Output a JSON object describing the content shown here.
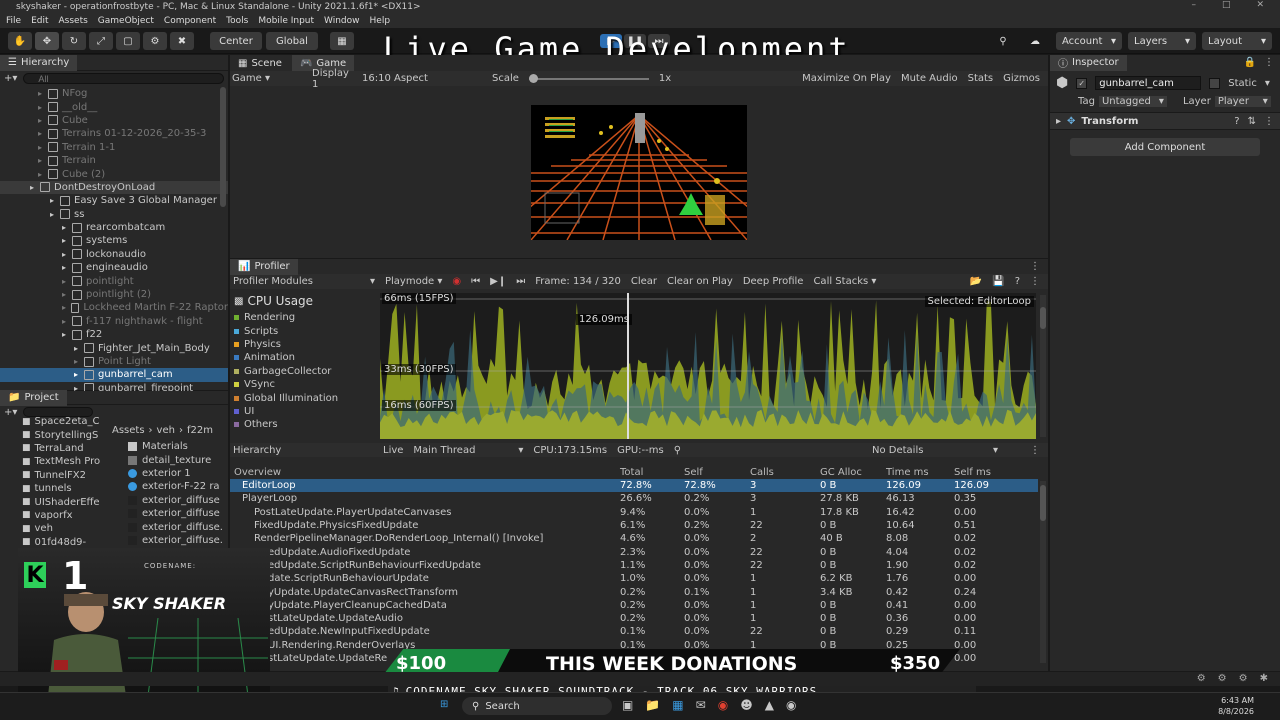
{
  "window": {
    "title": "skyshaker - operationfrostbyte - PC, Mac & Linux Standalone - Unity 2021.1.6f1* <DX11>"
  },
  "menu": [
    "File",
    "Edit",
    "Assets",
    "GameObject",
    "Component",
    "Tools",
    "Mobile Input",
    "Window",
    "Help"
  ],
  "toolbar": {
    "pivot": "Center",
    "space": "Global",
    "account": "Account",
    "layers": "Layers",
    "layout": "Layout"
  },
  "overlay": {
    "title": "Live Game Development"
  },
  "hierarchy": {
    "tab": "Hierarchy",
    "search_placeholder": "All",
    "rows": [
      {
        "label": "NFog",
        "indent": 0,
        "dim": true
      },
      {
        "label": "__old__",
        "indent": 0,
        "dim": true
      },
      {
        "label": "Cube",
        "indent": 0,
        "dim": true
      },
      {
        "label": "Terrains 01-12-2026_20-35-3",
        "indent": 0,
        "dim": true
      },
      {
        "label": "Terrain 1-1",
        "indent": 0,
        "dim": true
      },
      {
        "label": "Terrain",
        "indent": 0,
        "dim": true
      },
      {
        "label": "Cube (2)",
        "indent": 0,
        "dim": true
      },
      {
        "label": "DontDestroyOnLoad",
        "indent": -1,
        "dim": false
      },
      {
        "label": "Easy Save 3 Global Manager",
        "indent": 1,
        "dim": false
      },
      {
        "label": "ss",
        "indent": 1,
        "dim": false
      },
      {
        "label": "rearcombatcam",
        "indent": 2,
        "dim": false
      },
      {
        "label": "systems",
        "indent": 2,
        "dim": false
      },
      {
        "label": "lockonaudio",
        "indent": 2,
        "dim": false
      },
      {
        "label": "engineaudio",
        "indent": 2,
        "dim": false
      },
      {
        "label": "pointlight",
        "indent": 2,
        "dim": true
      },
      {
        "label": "pointlight (2)",
        "indent": 2,
        "dim": true
      },
      {
        "label": "Lockheed Martin F-22 Raptor",
        "indent": 2,
        "dim": true
      },
      {
        "label": "f-117 nighthawk - flight",
        "indent": 2,
        "dim": true
      },
      {
        "label": "f22",
        "indent": 2,
        "dim": false
      },
      {
        "label": "Fighter_Jet_Main_Body",
        "indent": 3,
        "dim": false
      },
      {
        "label": "Point Light",
        "indent": 3,
        "dim": true
      },
      {
        "label": "gunbarrel_cam",
        "indent": 3,
        "dim": false
      },
      {
        "label": "gunbarrel_firepoint",
        "indent": 3,
        "dim": false
      }
    ]
  },
  "project": {
    "tab": "Project",
    "breadcrumb": [
      "Assets",
      "veh",
      "f22m"
    ],
    "folders": [
      "Space2eta_C",
      "StorytellingS",
      "TerraLand",
      "TextMesh Pro",
      "TunnelFX2",
      "tunnels",
      "UIShaderEffe",
      "vaporfx",
      "veh",
      "01fd48d9-"
    ],
    "files": [
      "Materials",
      "detail_texture",
      "exterior 1",
      "exterior-F-22 ra",
      "exterior_diffuse",
      "exterior_diffuse",
      "exterior_diffuse.",
      "exterior_diffuse."
    ]
  },
  "scene": {
    "tabs": [
      "Scene",
      "Game"
    ],
    "display": "Game",
    "display_num": "Display 1",
    "aspect": "16:10 Aspect",
    "scale_label": "Scale",
    "scale_value": "1x",
    "right_items": [
      "Maximize On Play",
      "Mute Audio",
      "Stats",
      "Gizmos"
    ]
  },
  "profiler": {
    "tab": "Profiler",
    "modules": "Profiler Modules",
    "mode": "Playmode",
    "frame": "Frame: 134 / 320",
    "buttons": [
      "Clear",
      "Clear on Play",
      "Deep Profile",
      "Call Stacks"
    ],
    "module_name": "CPU Usage",
    "legend": [
      {
        "name": "Rendering",
        "color": "#70b030"
      },
      {
        "name": "Scripts",
        "color": "#4aa8d8"
      },
      {
        "name": "Physics",
        "color": "#e8a020"
      },
      {
        "name": "Animation",
        "color": "#3a7ac0"
      },
      {
        "name": "GarbageCollector",
        "color": "#b0b060"
      },
      {
        "name": "VSync",
        "color": "#d0d040"
      },
      {
        "name": "Global Illumination",
        "color": "#d08030"
      },
      {
        "name": "UI",
        "color": "#6060d0"
      },
      {
        "name": "Others",
        "color": "#8a6aa0"
      }
    ],
    "lines": [
      "66ms (15FPS)",
      "33ms (30FPS)",
      "16ms (60FPS)"
    ],
    "selected_label": "Selected: EditorLoop",
    "marker": "126.09ms",
    "view": "Hierarchy",
    "live": "Live",
    "thread": "Main Thread",
    "cpu": "CPU:173.15ms",
    "gpu": "GPU:--ms",
    "details": "No Details",
    "columns": [
      "Overview",
      "Total",
      "Self",
      "Calls",
      "GC Alloc",
      "Time ms",
      "Self ms"
    ],
    "rows": [
      [
        "EditorLoop",
        "72.8%",
        "72.8%",
        "3",
        "0 B",
        "126.09",
        "126.09"
      ],
      [
        "PlayerLoop",
        "26.6%",
        "0.2%",
        "3",
        "27.8 KB",
        "46.13",
        "0.35"
      ],
      [
        "PostLateUpdate.PlayerUpdateCanvases",
        "9.4%",
        "0.0%",
        "1",
        "17.8 KB",
        "16.42",
        "0.00"
      ],
      [
        "FixedUpdate.PhysicsFixedUpdate",
        "6.1%",
        "0.2%",
        "22",
        "0 B",
        "10.64",
        "0.51"
      ],
      [
        "RenderPipelineManager.DoRenderLoop_Internal() [Invoke]",
        "4.6%",
        "0.0%",
        "2",
        "40 B",
        "8.08",
        "0.02"
      ],
      [
        "edUpdate.AudioFixedUpdate",
        "2.3%",
        "0.0%",
        "22",
        "0 B",
        "4.04",
        "0.02"
      ],
      [
        "edUpdate.ScriptRunBehaviourFixedUpdate",
        "1.1%",
        "0.0%",
        "22",
        "0 B",
        "1.90",
        "0.02"
      ],
      [
        "date.ScriptRunBehaviourUpdate",
        "1.0%",
        "0.0%",
        "1",
        "6.2 KB",
        "1.76",
        "0.00"
      ],
      [
        "yUpdate.UpdateCanvasRectTransform",
        "0.2%",
        "0.1%",
        "1",
        "3.4 KB",
        "0.42",
        "0.24"
      ],
      [
        "yUpdate.PlayerCleanupCachedData",
        "0.2%",
        "0.0%",
        "1",
        "0 B",
        "0.41",
        "0.00"
      ],
      [
        "stLateUpdate.UpdateAudio",
        "0.2%",
        "0.0%",
        "1",
        "0 B",
        "0.36",
        "0.00"
      ],
      [
        "edUpdate.NewInputFixedUpdate",
        "0.1%",
        "0.0%",
        "22",
        "0 B",
        "0.29",
        "0.11"
      ],
      [
        "UI.Rendering.RenderOverlays",
        "0.1%",
        "0.0%",
        "1",
        "0 B",
        "0.25",
        "0.00"
      ],
      [
        "stLateUpdate.UpdateRe",
        "0.1%",
        "0.0%",
        "1",
        "0 B",
        "0.21",
        "0.00"
      ]
    ]
  },
  "inspector": {
    "tab": "Inspector",
    "object_name": "gunbarrel_cam",
    "static": "Static",
    "tag_label": "Tag",
    "tag": "Untagged",
    "layer_label": "Layer",
    "layer": "Player",
    "component": "Transform",
    "add_component": "Add Component"
  },
  "stream": {
    "codename": "CODENAME:",
    "game": "SKY SHAKER",
    "number": "1",
    "donation_left": "$100",
    "donation_title": "THIS WEEK DONATIONS",
    "donation_right": "$350",
    "ticker": "CODENAME SKY SHAKER SOUNDTRACK - TRACK 06 SKY WARRIORS"
  },
  "taskbar": {
    "search": "Search",
    "time": "6:43 AM",
    "date": "8/8/2026"
  }
}
